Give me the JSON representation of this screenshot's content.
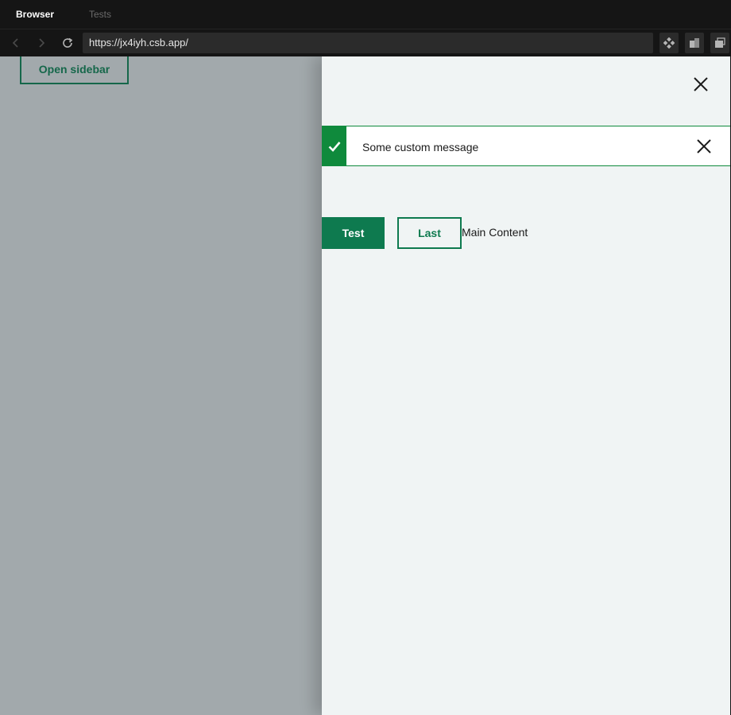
{
  "browser": {
    "tabs": [
      {
        "label": "Browser",
        "active": true
      },
      {
        "label": "Tests",
        "active": false
      }
    ],
    "url": "https://jx4iyh.csb.app/",
    "nav_icons": [
      "back-arrow-icon",
      "forward-arrow-icon",
      "reload-icon"
    ],
    "tool_icons": [
      "codesandbox-icon",
      "split-view-icon",
      "new-window-icon"
    ]
  },
  "page": {
    "open_sidebar_label": "Open sidebar",
    "sidebar": {
      "alert": {
        "message": "Some custom message",
        "status": "success",
        "status_icon": "checkmark-icon",
        "color": "#0f8a3c"
      },
      "primary_button": "Test",
      "secondary_button": "Last",
      "content_text": "Main Content",
      "accent_color": "#0e7a4f"
    }
  }
}
